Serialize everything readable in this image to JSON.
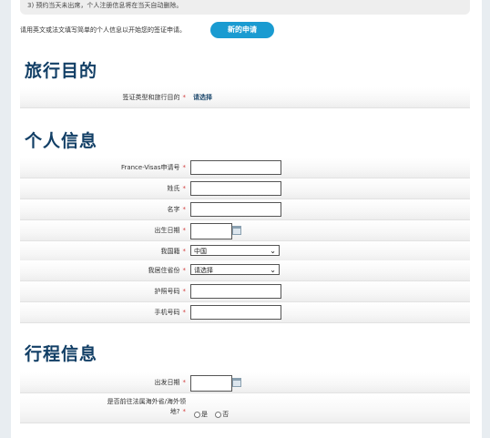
{
  "notice": "3) 预约当天未出席，个人注册信息将在当天自动删除。",
  "intro": "请用英文或法文填写简单的个人信息以开始您的签证申请。",
  "new_application_button": "新的申请",
  "sections": {
    "travel_purpose": {
      "title": "旅行目的",
      "visa_type_label": "签证类型和旅行目的",
      "choose_link": "请选择"
    },
    "personal_info": {
      "title": "个人信息",
      "fields": {
        "application_no": "France-Visas申请号",
        "surname": "姓氏",
        "given_name": "名字",
        "birth_date": "出生日期",
        "nationality": "我国籍",
        "residence_province": "我居住省份",
        "passport_no": "护照号码",
        "mobile_no": "手机号码"
      },
      "nationality_value": "中国",
      "province_value": "请选择"
    },
    "itinerary": {
      "title": "行程信息",
      "departure_label": "出发日期",
      "overseas_label_1": "是否前往法属海外省/海外领",
      "overseas_label_2": "地?",
      "option_yes": "是",
      "option_no": "否"
    }
  },
  "required_mark": "*",
  "select_arrow": "⌄"
}
